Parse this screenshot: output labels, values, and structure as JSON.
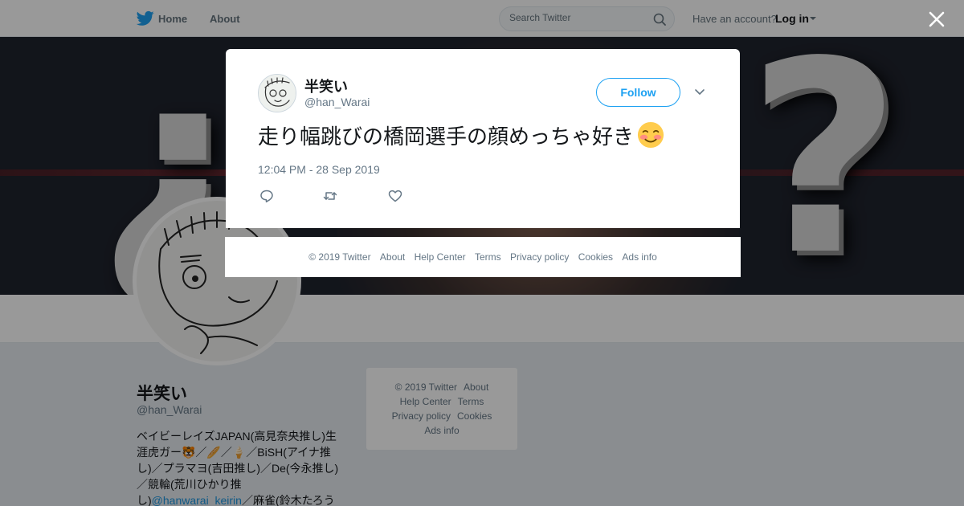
{
  "nav": {
    "home": "Home",
    "about": "About",
    "search_placeholder": "Search Twitter",
    "have_account": "Have an account?",
    "login": "Log in"
  },
  "profile": {
    "name": "半笑い",
    "handle": "@han_Warai",
    "bio_line1": "ベイビーレイズJAPAN(高見奈央推し)生",
    "bio_line2": "涯虎ガー🐯／🥖／🍦／BiSH(アイナ推",
    "bio_line3": "し)／プラマヨ(吉田推し)／De(今永推し)",
    "bio_line4": "／競輪(荒川ひかり推",
    "bio_line5_prefix": "し)",
    "bio_link": "@hanwarai_keirin",
    "bio_line5_suffix": "／麻雀(鈴木たろう"
  },
  "sidebar_footer": {
    "copyright": "© 2019 Twitter",
    "about": "About",
    "help": "Help Center",
    "terms": "Terms",
    "privacy": "Privacy policy",
    "cookies": "Cookies",
    "ads": "Ads info"
  },
  "tweet": {
    "name": "半笑い",
    "handle": "@han_Warai",
    "follow": "Follow",
    "text": "走り幅跳びの橋岡選手の顔めっちゃ好き",
    "emoji": "smiling-face-blushing",
    "timestamp": "12:04 PM - 28 Sep 2019"
  },
  "overlay_footer": {
    "copyright": "© 2019 Twitter",
    "about": "About",
    "help": "Help Center",
    "terms": "Terms",
    "privacy": "Privacy policy",
    "cookies": "Cookies",
    "ads": "Ads info"
  },
  "colors": {
    "brand": "#1da1f2",
    "text": "#14171a",
    "muted": "#657786",
    "page_bg": "#e6ecf0"
  }
}
